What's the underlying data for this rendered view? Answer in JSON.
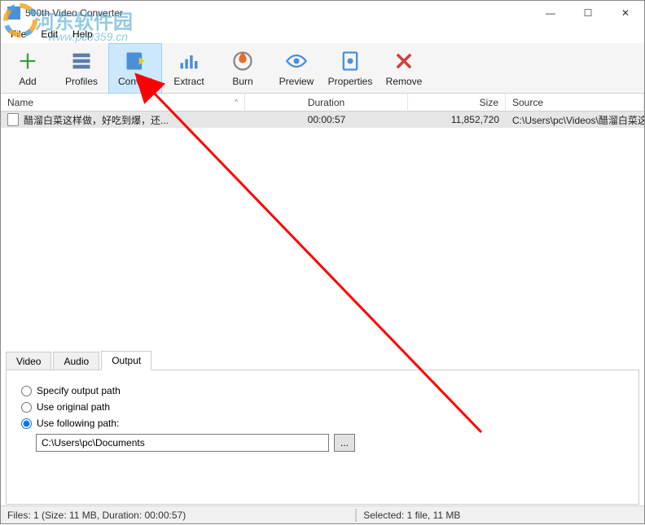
{
  "window": {
    "title": "500th Video Converter",
    "min": "—",
    "max": "☐",
    "close": "✕"
  },
  "menu": {
    "file": "File",
    "edit": "Edit",
    "help": "Help"
  },
  "toolbar": {
    "add": "Add",
    "profiles": "Profiles",
    "convert": "Convert",
    "extract": "Extract",
    "burn": "Burn",
    "preview": "Preview",
    "properties": "Properties",
    "remove": "Remove"
  },
  "columns": {
    "name": "Name",
    "duration": "Duration",
    "size": "Size",
    "source": "Source"
  },
  "row": {
    "name": "醋溜白菜这样做，好吃到爆，还...",
    "duration": "00:00:57",
    "size": "11,852,720",
    "source": "C:\\Users\\pc\\Videos\\醋溜白菜这..."
  },
  "tabs": {
    "video": "Video",
    "audio": "Audio",
    "output": "Output"
  },
  "output": {
    "specify": "Specify output path",
    "original": "Use original path",
    "following": "Use following path:",
    "path": "C:\\Users\\pc\\Documents",
    "browse": "..."
  },
  "status": {
    "left": "Files: 1 (Size: 11 MB, Duration: 00:00:57)",
    "right": "Selected: 1 file, 11 MB"
  },
  "watermark": {
    "text": "河东软件园",
    "url": "www.pc0359.cn"
  }
}
